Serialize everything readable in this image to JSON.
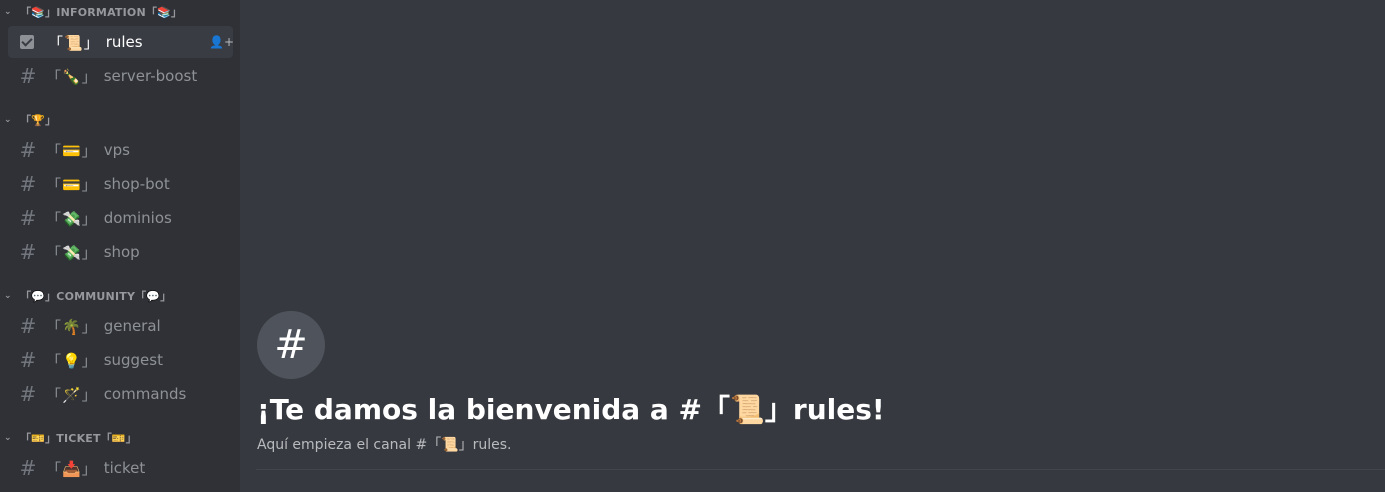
{
  "sidebar": {
    "categories": [
      {
        "label": "「📚」INFORMATION「📚」"
      },
      {
        "label": "「🏆」"
      },
      {
        "label": "「💬」COMMUNITY「💬」"
      },
      {
        "label": "「🎫」TICKET「🎫」"
      }
    ],
    "channels": [
      {
        "emoji": "「📜」",
        "name": "rules"
      },
      {
        "emoji": "「🍾」",
        "name": "server-boost"
      },
      {
        "emoji": "「💳」",
        "name": "vps"
      },
      {
        "emoji": "「💳」",
        "name": "shop-bot"
      },
      {
        "emoji": "「💸」",
        "name": "dominios"
      },
      {
        "emoji": "「💸」",
        "name": "shop"
      },
      {
        "emoji": "「🌴」",
        "name": "general"
      },
      {
        "emoji": "「💡」",
        "name": "suggest"
      },
      {
        "emoji": "「🪄」",
        "name": "commands"
      },
      {
        "emoji": "「📥」",
        "name": "ticket"
      }
    ],
    "hash_symbol": "#",
    "invite_symbol": "👤+"
  },
  "main": {
    "badge_symbol": "#",
    "welcome_title": "¡Te damos la bienvenida a #「📜」rules!",
    "welcome_subtitle": "Aquí empieza el canal #「📜」rules."
  }
}
